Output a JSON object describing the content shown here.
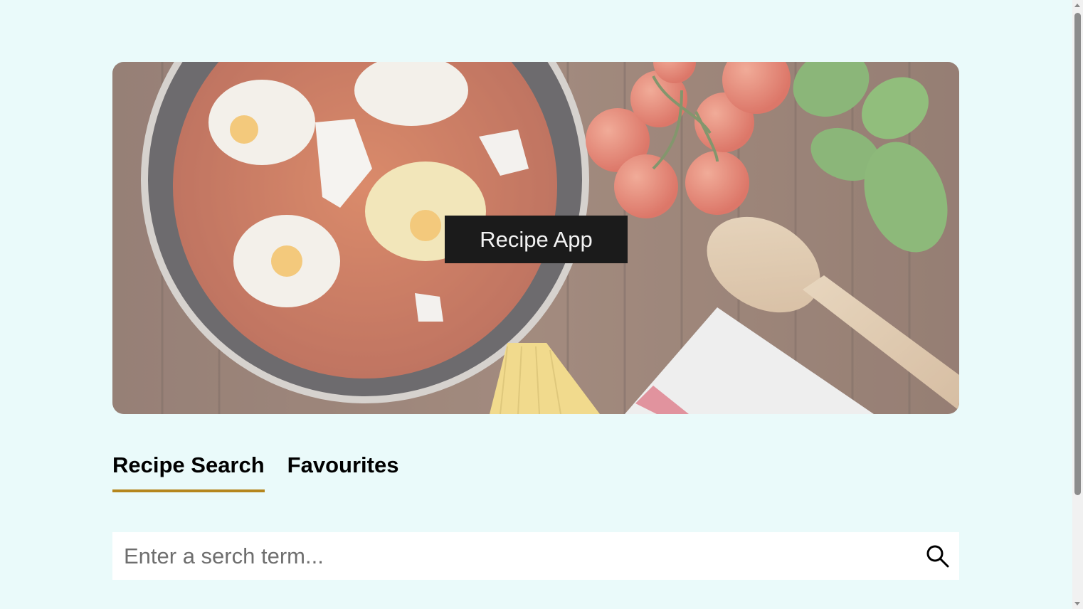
{
  "hero": {
    "title": "Recipe App"
  },
  "tabs": [
    {
      "label": "Recipe Search",
      "active": true
    },
    {
      "label": "Favourites",
      "active": false
    }
  ],
  "search": {
    "value": "",
    "placeholder": "Enter a serch term...",
    "icon": "search-icon"
  },
  "colors": {
    "page_background": "#eafafa",
    "tab_underline": "#b5861d",
    "title_box": "#1b1b1b"
  }
}
